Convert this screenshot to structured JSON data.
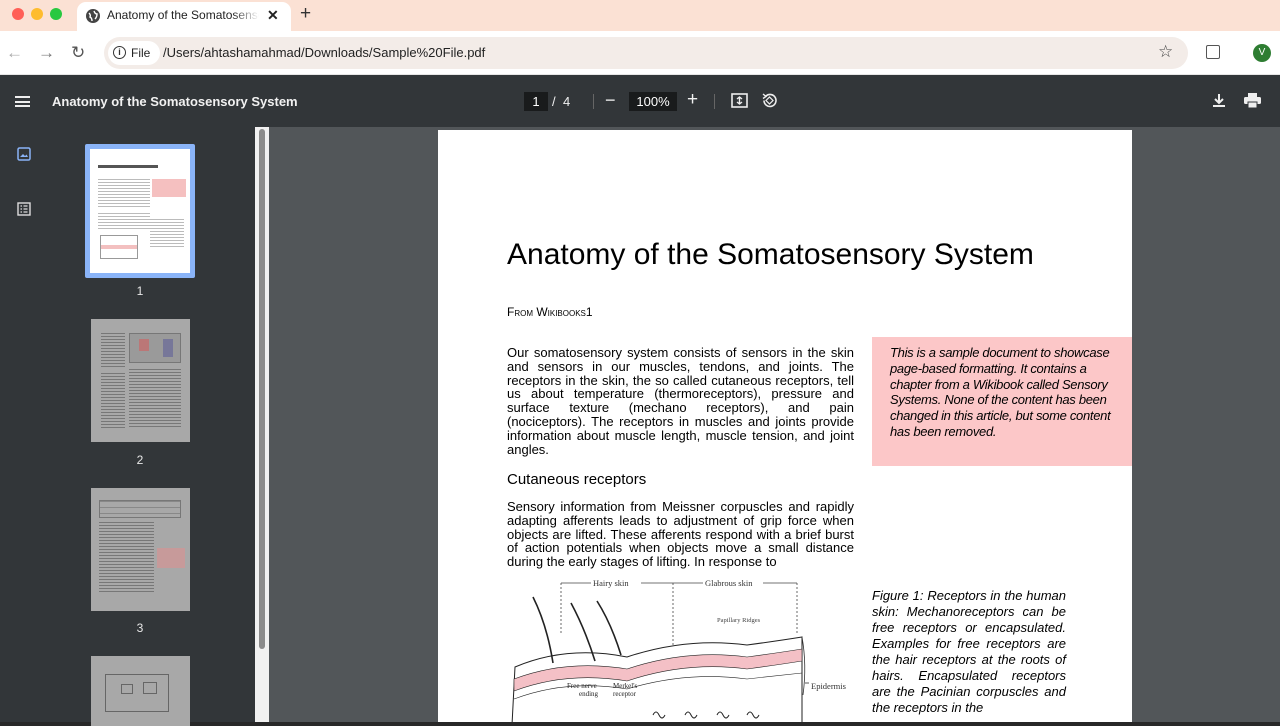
{
  "browser": {
    "tab_title": "Anatomy of the Somatosensory System",
    "tab_close": "✕",
    "new_tab": "+",
    "nav_back": "←",
    "nav_forward": "→",
    "nav_reload": "↻",
    "site_chip": "File",
    "url": "/Users/ahtashamahmad/Downloads/Sample%20File.pdf",
    "bookmark_star": "☆",
    "profile_initial": "V"
  },
  "pdf_toolbar": {
    "title": "Anatomy of the Somatosensory System",
    "current_page": "1",
    "page_separator": "/",
    "total_pages": "4",
    "zoom_out": "−",
    "zoom": "100%",
    "zoom_in": "+"
  },
  "thumbnails": [
    {
      "label": "1",
      "selected": true
    },
    {
      "label": "2",
      "selected": false
    },
    {
      "label": "3",
      "selected": false
    }
  ],
  "document": {
    "title": "Anatomy of the Somatosensory System",
    "from": "From Wikibooks1",
    "intro": "Our somatosensory system consists of sensors in the skin and sensors in our muscles, tendons, and joints. The receptors in the skin, the so called cutaneous receptors, tell us about temperature (thermoreceptors), pressure and surface texture (mechano receptors), and pain (nociceptors). The receptors in muscles and joints provide information about muscle length, muscle tension, and joint angles.",
    "sidenote": "This is a sample document to showcase page-based formatting. It contains a chapter from a Wikibook called Sensory Systems. None of the content has been changed in this article, but some content has been removed.",
    "heading": "Cutaneous receptors",
    "para2": "Sensory information from Meissner corpuscles and rapidly adapting afferents leads to adjustment of grip force when objects are lifted. These afferents respond with a brief burst of action potentials when objects move a small distance during the early stages of lifting. In response to",
    "figure_caption": "Figure 1: Receptors in the human skin: Mechanoreceptors can be free receptors or encapsulated. Examples for free receptors are the hair receptors at the roots of hairs. Encapsulated receptors are the Pacinian corpuscles and the receptors in the",
    "diagram_labels": {
      "hairy": "Hairy skin",
      "glabrous": "Glabrous skin",
      "papillary": "Papillary Ridges",
      "epidermis": "Epidermis",
      "free_nerve": "Free nerve",
      "ending": "ending",
      "merkel": "Merkel's",
      "receptor": "receptor"
    }
  },
  "colors": {
    "tabbar": "#fbe1d4",
    "pdf_toolbar": "#323639",
    "viewer_bg": "#525659",
    "sidenote_bg": "#fcc7c8",
    "thumb_selection": "#8ab4f8",
    "avatar": "#2e7d32"
  }
}
